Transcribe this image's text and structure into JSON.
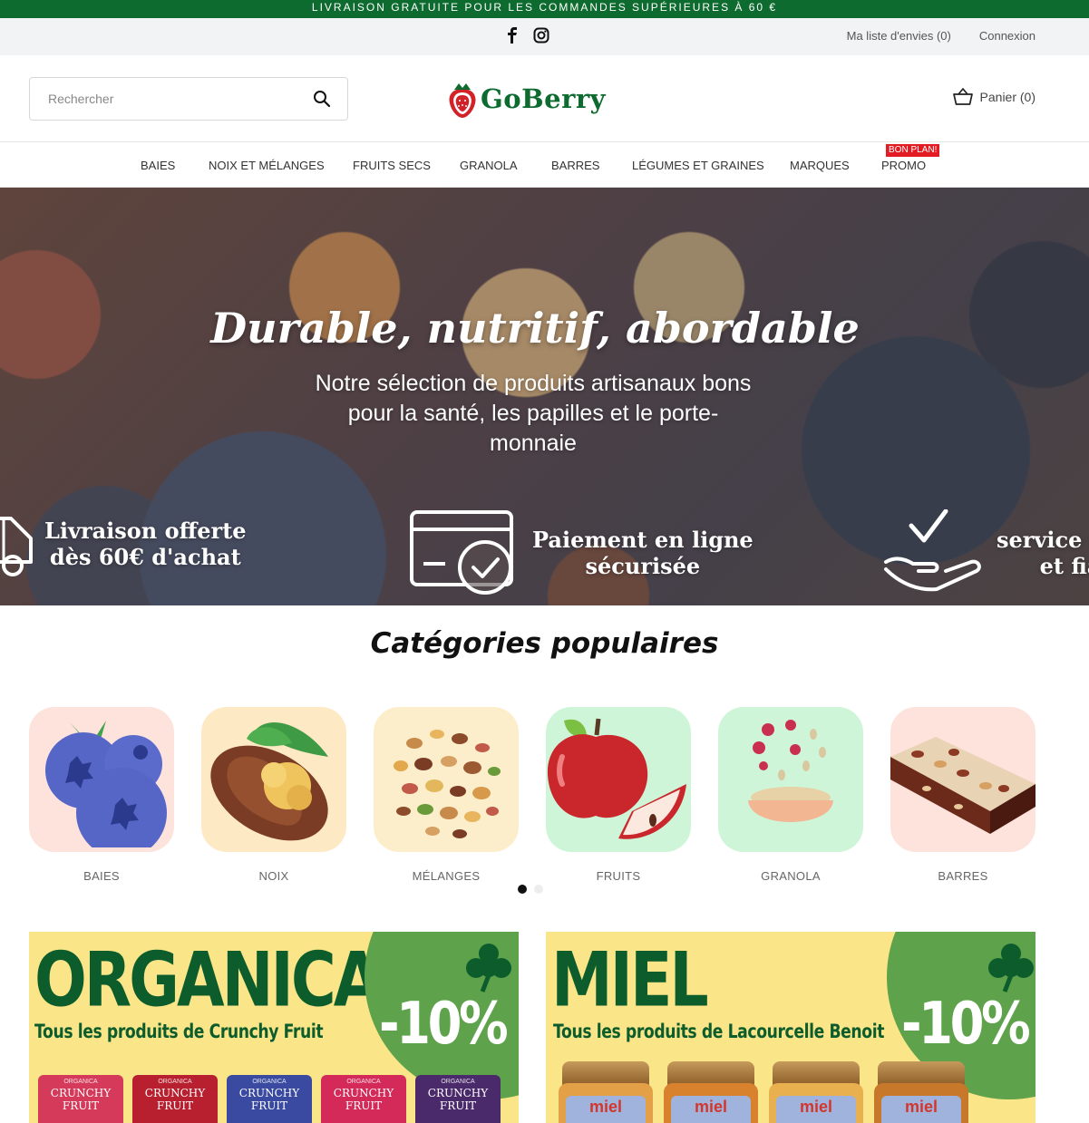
{
  "announcement": "LIVRAISON GRATUITE POUR LES COMMANDES SUPÉRIEURES À 60 €",
  "topbar": {
    "socials": [
      "facebook-icon",
      "instagram-icon"
    ],
    "wishlist": "Ma liste d'envies (0)",
    "login": "Connexion"
  },
  "header": {
    "search_placeholder": "Rechercher",
    "logo_text": "GoBerry",
    "cart": "Panier (0)"
  },
  "nav": {
    "items": [
      "BAIES",
      "NOIX ET MÉLANGES",
      "FRUITS SECS",
      "GRANOLA",
      "BARRES",
      "LÉGUMES ET GRAINES",
      "MARQUES",
      "PROMO"
    ],
    "promo_badge": "BON PLAN!"
  },
  "hero": {
    "title": "Durable, nutritif, abordable",
    "subtitle": "Notre sélection de produits artisanaux bons pour la santé, les papilles et le porte-monnaie",
    "features": [
      {
        "line1": "Livraison offerte",
        "line2": "dès 60€ d'achat",
        "icon": "truck-icon"
      },
      {
        "line1": "Paiement en ligne",
        "line2": "sécurisée",
        "icon": "secure-payment-icon"
      },
      {
        "line1": "service r",
        "line2": "et fia",
        "icon": "hand-check-icon"
      }
    ]
  },
  "categories": {
    "title": "Catégories populaires",
    "items": [
      {
        "label": "BAIES",
        "bg": "#fde3dc"
      },
      {
        "label": "NOIX",
        "bg": "#fde9c4"
      },
      {
        "label": "MÉLANGES",
        "bg": "#fdeecb"
      },
      {
        "label": "FRUITS",
        "bg": "#cff5d9"
      },
      {
        "label": "GRANOLA",
        "bg": "#cff5d9"
      },
      {
        "label": "BARRES",
        "bg": "#fde3dc"
      }
    ],
    "carousel_pages": 2,
    "active_page": 1
  },
  "promos": [
    {
      "brand": "ORGANICA",
      "tagline": "Tous les produits de Crunchy Fruit",
      "discount": "-10%",
      "product_label": "CRUNCHY FRUIT",
      "product_small": "ORGANICA"
    },
    {
      "brand": "MIEL",
      "tagline": "Tous les produits de Lacourcelle Benoit",
      "discount": "-10%",
      "product_label": "miel"
    }
  ],
  "colors": {
    "brand_green": "#0e6b2f",
    "promo_yellow": "#fbe589",
    "promo_circle": "#5ea24b",
    "badge_red": "#e31b23"
  }
}
